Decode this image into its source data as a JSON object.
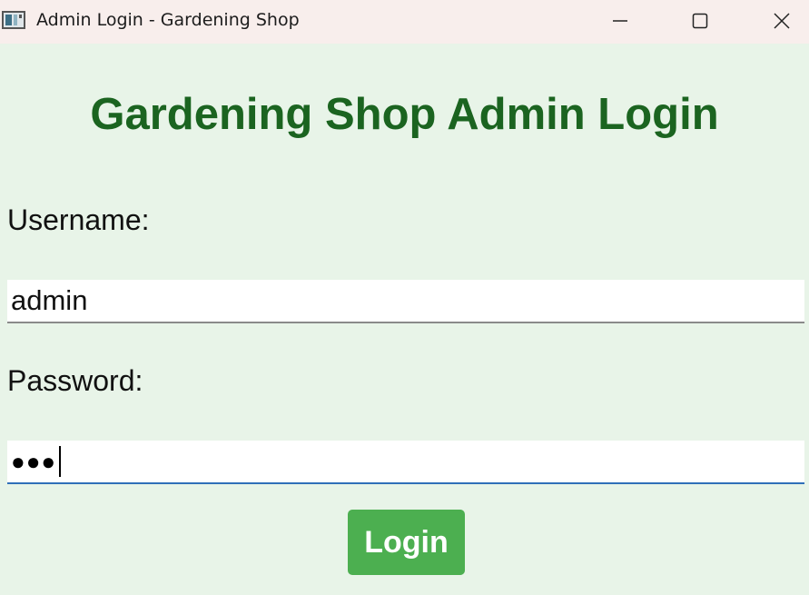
{
  "window": {
    "title": "Admin Login - Gardening Shop",
    "controls": {
      "minimize_icon": "minimize-icon",
      "maximize_icon": "maximize-icon",
      "close_icon": "close-icon"
    }
  },
  "form": {
    "heading": "Gardening Shop Admin Login",
    "username": {
      "label": "Username:",
      "value": "admin"
    },
    "password": {
      "label": "Password:",
      "masked_value": "●●●"
    },
    "login_button": "Login"
  },
  "colors": {
    "background": "#e8f4e8",
    "titlebar": "#f8eeec",
    "heading": "#1b6420",
    "button": "#4caf50",
    "focus_underline": "#2f6fb8"
  }
}
